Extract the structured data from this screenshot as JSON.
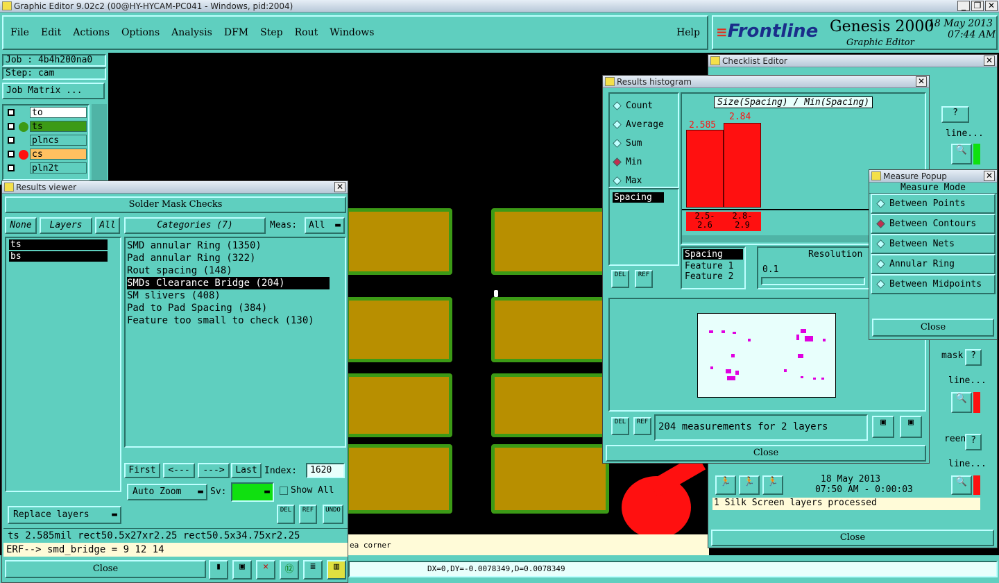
{
  "app": {
    "title": "Graphic Editor 9.02c2 (00@HY-HYCAM-PC041 - Windows, pid:2004)"
  },
  "menu": {
    "items": [
      "File",
      "Edit",
      "Actions",
      "Options",
      "Analysis",
      "DFM",
      "Step",
      "Rout",
      "Windows"
    ],
    "help": "Help"
  },
  "brand": {
    "logo": "Frontline",
    "product": "Genesis 2000",
    "subtitle": "Graphic Editor",
    "date": "18 May 2013",
    "time": "07:44 AM"
  },
  "job": {
    "job_label": "Job : 4b4h200na0",
    "step_label": "Step: cam",
    "matrix_button": "Job Matrix ..."
  },
  "layers": [
    {
      "name": "to",
      "color": "#ffffff"
    },
    {
      "name": "ts",
      "color": "#3c9a16"
    },
    {
      "name": "plncs",
      "color": "#5fcfbf"
    },
    {
      "name": "cs",
      "color": "#ff1010"
    },
    {
      "name": "pln2t",
      "color": "#5fcfbf"
    }
  ],
  "results_viewer": {
    "title": "Results viewer",
    "header": "Solder Mask Checks",
    "none": "None",
    "layers_label": "Layers",
    "all": "All",
    "layer_list": [
      "ts",
      "bs"
    ],
    "categories_label": "Categories (7)",
    "meas_label": "Meas:",
    "meas_value": "All",
    "categories": [
      "SMD annular Ring (1350)",
      "Pad annular Ring (322)",
      "Rout spacing (148)",
      "SMDs Clearance Bridge (204)",
      "SM slivers (408)",
      "Pad to Pad Spacing (384)",
      "Feature too small to check (130)"
    ],
    "first": "First",
    "prev": "<---",
    "next": "--->",
    "last": "Last",
    "index_label": "Index:",
    "index_value": "1620",
    "auto_zoom": "Auto Zoom",
    "sv_label": "Sv:",
    "show_all": "Show All",
    "replace_layers": "Replace layers",
    "del": "DEL",
    "ref": "REF",
    "undo": "UNDO",
    "status": "ts 2.585mil   rect50.5x27xr2.25   rect50.5x34.75xr2.25",
    "erf": "ERF--> smd_bridge = 9 12 14",
    "close": "Close"
  },
  "histogram": {
    "title": "Results histogram",
    "modes": [
      "Count",
      "Average",
      "Sum",
      "Min",
      "Max"
    ],
    "selected_mode": "Min",
    "chart_title": "Size(Spacing) / Min(Spacing)",
    "bars": [
      {
        "range": "2.5-\n2.6",
        "value": "2.585"
      },
      {
        "range": "2.8-\n2.9",
        "value": "2.84"
      }
    ],
    "bar_ranges": [
      "2.5-",
      "2.6",
      "2.8-",
      "2.9"
    ],
    "list_item": "Spacing",
    "fields": [
      "Spacing",
      "Feature 1",
      "Feature 2"
    ],
    "resolution_label": "Resolution",
    "resolution_value": "0.1",
    "summary": "204 measurements for 2 layers",
    "del": "DEL",
    "ref": "REF",
    "close": "Close"
  },
  "checklist": {
    "title": "Checklist Editor",
    "frag1": "line...",
    "frag2": "mask",
    "frag3": "line...",
    "frag4": "reen",
    "frag5": "line...",
    "date": "18 May 2013",
    "time_line": "07:50 AM - 0:00:03",
    "message": "1 Silk Screen layers processed",
    "close": "Close"
  },
  "measure": {
    "title": "Measure Popup",
    "mode_label": "Measure Mode",
    "modes": [
      "Between Points",
      "Between Contours",
      "Between Nets",
      "Annular Ring",
      "Between Midpoints"
    ],
    "selected": "Between Contours",
    "close": "Close"
  },
  "canvas": {
    "note": "ea corner",
    "coords": "DX=0,DY=-0.0078349,D=0.0078349"
  }
}
